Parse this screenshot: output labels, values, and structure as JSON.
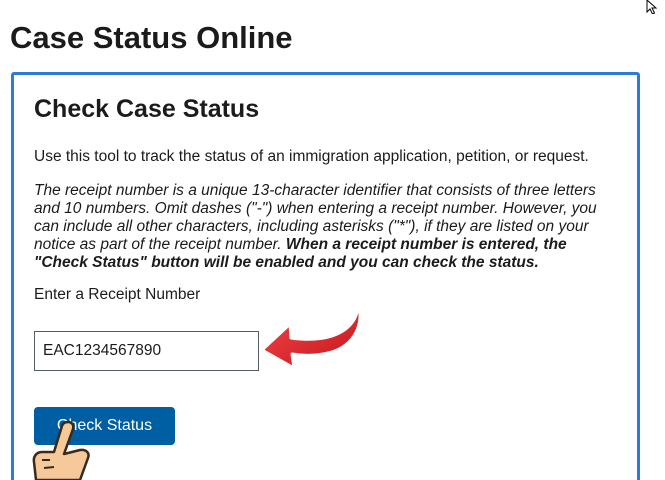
{
  "header": {
    "title": "Case Status Online"
  },
  "card": {
    "title": "Check Case Status",
    "intro": "Use this tool to track the status of an immigration application, petition, or request.",
    "note_italic": "The receipt number is a unique 13-character identifier that consists of three letters and 10 numbers. Omit dashes (\"-\") when entering a receipt number. However, you can include all other characters, including asterisks (\"*\"), if they are listed on your notice as part of the receipt number. ",
    "note_bold": "When a receipt number is entered, the \"Check Status\" button will be enabled and you can check the status.",
    "field_label": "Enter a Receipt Number",
    "receipt_value": "EAC1234567890",
    "button_label": "Check Status"
  },
  "colors": {
    "card_border": "#2b7cd3",
    "button_bg": "#005ea2",
    "arrow": "#e3262b",
    "hand": "#f6c99a"
  },
  "icons": {
    "arrow": "red-curved-arrow-icon",
    "hand": "pointing-hand-icon",
    "cursor": "mouse-cursor-icon"
  }
}
